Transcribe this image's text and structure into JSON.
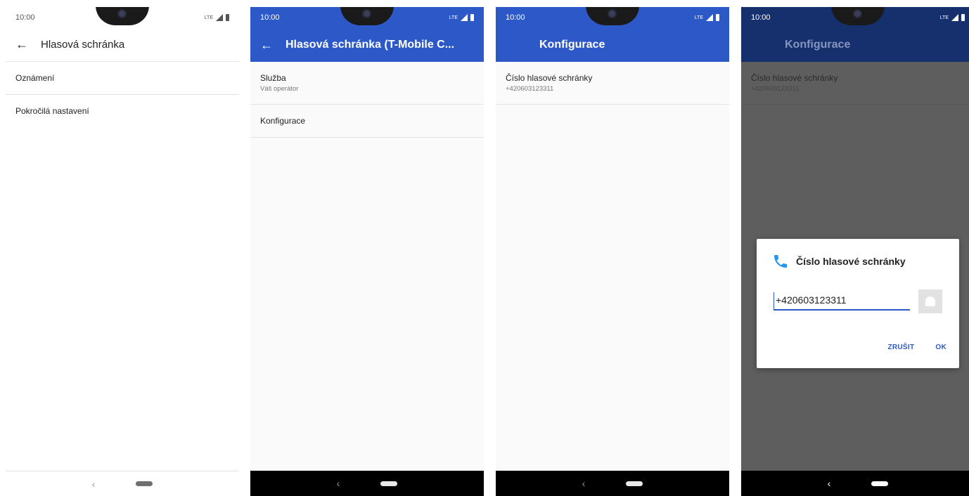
{
  "status": {
    "time": "10:00",
    "network": "LTE"
  },
  "screen1": {
    "title": "Hlasová schránka",
    "items": [
      {
        "title": "Oznámení"
      },
      {
        "title": "Pokročilá nastavení"
      }
    ]
  },
  "screen2": {
    "title": "Hlasová schránka (T-Mobile C...",
    "items": [
      {
        "title": "Služba",
        "subtitle": "Váš operátor"
      },
      {
        "title": "Konfigurace"
      }
    ]
  },
  "screen3": {
    "title": "Konfigurace",
    "items": [
      {
        "title": "Číslo hlasové schránky",
        "subtitle": "+420603123311"
      }
    ]
  },
  "screen4": {
    "title": "Konfigurace",
    "items": [
      {
        "title": "Číslo hlasové schránky",
        "subtitle": "+420603123311"
      }
    ],
    "dialog": {
      "icon": "phone-icon",
      "title": "Číslo hlasové schránky",
      "input_value": "+420603123311",
      "cancel_label": "ZRUŠIT",
      "ok_label": "OK"
    }
  },
  "colors": {
    "accent": "#2d59c8",
    "dim_bar": "#16306e",
    "scrim": "#5e5e5e"
  }
}
